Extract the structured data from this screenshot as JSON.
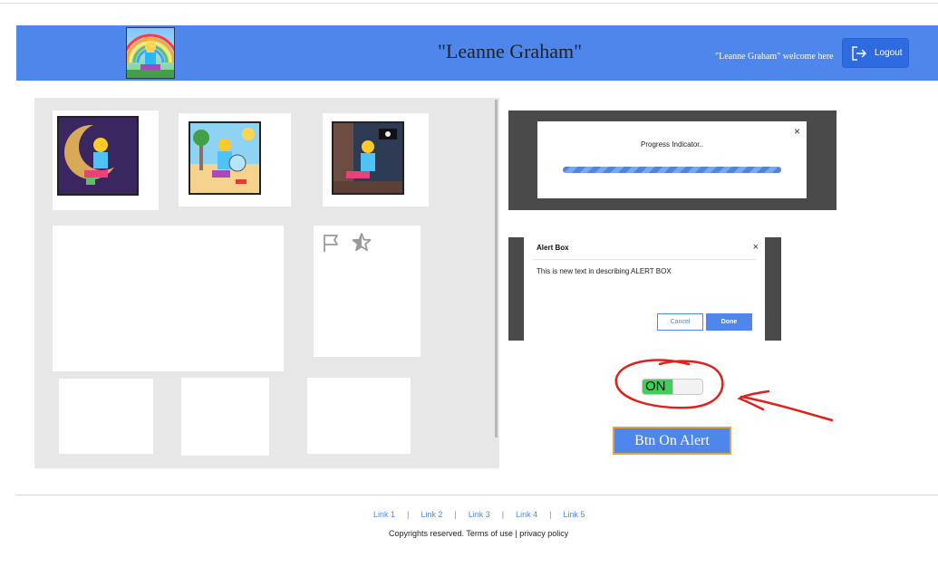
{
  "header": {
    "title": "\"Leanne Graham\"",
    "welcome": "\"Leanne Graham\" welcome here",
    "logout_label": "Logout"
  },
  "progress_dialog": {
    "label": "Progress Indicator..",
    "close": "×"
  },
  "alert_box": {
    "title": "Alert Box",
    "close": "×",
    "body": "This is new text in describing ALERT BOX",
    "cancel_label": "Cancel",
    "done_label": "Done"
  },
  "toggle": {
    "label": "ON",
    "state": "on"
  },
  "btn_alert_label": "Btn On Alert",
  "footer": {
    "links": [
      "Link 1",
      "Link 2",
      "Link 3",
      "Link 4",
      "Link 5"
    ],
    "separator": "|",
    "copyright": "Copyrights reserved. Terms of use | privacy policy"
  },
  "colors": {
    "header_bg": "#4e86ec",
    "annotation": "#e0201b",
    "toggle_on": "#3fcf58"
  },
  "icons": {
    "card_flag": "flag-icon",
    "card_star": "star-icon",
    "logout": "logout-icon"
  }
}
